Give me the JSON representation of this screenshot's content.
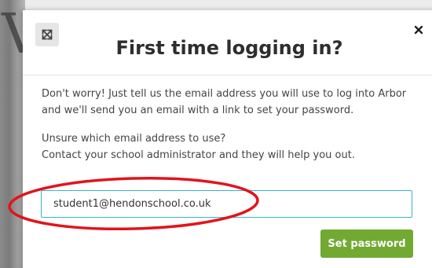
{
  "dialog": {
    "title": "First time logging in?",
    "intro": "Don't worry! Just tell us the email address you will use to log into Arbor and we'll send you an email with a link to set your password.",
    "help_line1": "Unsure which email address to use?",
    "help_line2": "Contact your school administrator and they will help you out.",
    "email_value": "student1@hendonschool.co.uk",
    "submit_label": "Set password"
  },
  "icons": {
    "expand": "expand-icon",
    "close": "close-icon"
  },
  "colors": {
    "primary_button": "#72a932",
    "input_border": "#3ab0c9",
    "annotation": "#e1141b"
  }
}
